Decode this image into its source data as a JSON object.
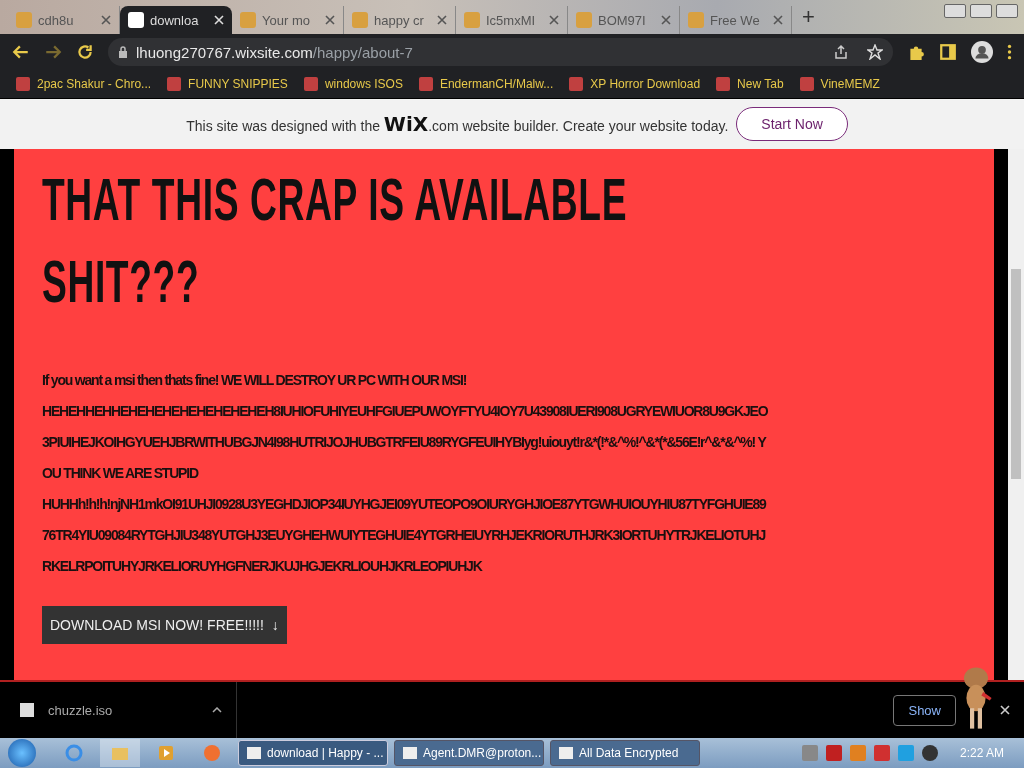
{
  "tabs": [
    {
      "title": "cdh8u",
      "selected": false
    },
    {
      "title": "downloa",
      "selected": true
    },
    {
      "title": "Your mo",
      "selected": false
    },
    {
      "title": "happy cr",
      "selected": false
    },
    {
      "title": "Ic5mxMI",
      "selected": false
    },
    {
      "title": "BOM97I",
      "selected": false
    },
    {
      "title": "Free We",
      "selected": false
    }
  ],
  "new_tab": "+",
  "address": {
    "host": "lhuong270767.wixsite.com",
    "path": "/happy/about-7"
  },
  "bookmarks": [
    {
      "label": "2pac Shakur - Chro..."
    },
    {
      "label": "FUNNY SNIPPIES"
    },
    {
      "label": "windows ISOS"
    },
    {
      "label": "EndermanCH/Malw..."
    },
    {
      "label": "XP Horror Download"
    },
    {
      "label": "New Tab"
    },
    {
      "label": "VineMEMZ"
    }
  ],
  "wix_banner": {
    "before": "This site was designed with the",
    "logo": "WiX",
    "after": ".com website builder. Create your website today.",
    "button": "Start Now"
  },
  "page": {
    "heading": "THAT THIS CRAP IS AVAILABLE SHIT???",
    "lines": [
      "If you want a msi then thats fine! WE WILL DESTROY UR PC WITH OUR MSI!",
      "HEHEHHEHHEHEHEHEHEHEHEHEHEH8IUHIOFUHIYEUHFGIUEPUWOYFTYU4IOY7U43908IUERI908UGRYEWIUOR8U9GKJEO3PIUIHEJKOIHGYUEHJBRWITHUBGJN4I98HUTRIJOJHUBGTRFEIU89RYGFEUIHYBIyg!uiouyt!r&*(!*&^%!^&*(*&56E!r^&*&^%! YOU THINK WE ARE STUPID",
      "HUHHh!h!h!njNH1mkOI91UHJI0928U3YEGHDJIOP34IUYHGJEI09YUTEOPO9OIURYGHJIOE87YTGWHUIOUYHIU87TYFGHUIE8976TR4YIU09084RYTGHJIU348YUTGHJ3EUYGHEHWUIYTEGHUIE4YTGRHEIUYRHJEKRIORUTHJRK3IORTUHYTRJKELIOTUHJRKELRPOITUHYJRKELIORUYHGFNERJKUJHGJEKRLIOUHJKRLEOPIUHJK"
    ],
    "download_button": "DOWNLOAD MSI NOW! FREE!!!!!  ↓"
  },
  "downloads": {
    "file": "chuzzle.iso",
    "show_all": "Show"
  },
  "taskbar": {
    "tasks": [
      {
        "label": "download | Happy - ...",
        "selected": true
      },
      {
        "label": "Agent.DMR@proton...",
        "selected": false
      },
      {
        "label": "All Data Encrypted",
        "selected": false
      }
    ],
    "clock": "2:22 AM"
  }
}
